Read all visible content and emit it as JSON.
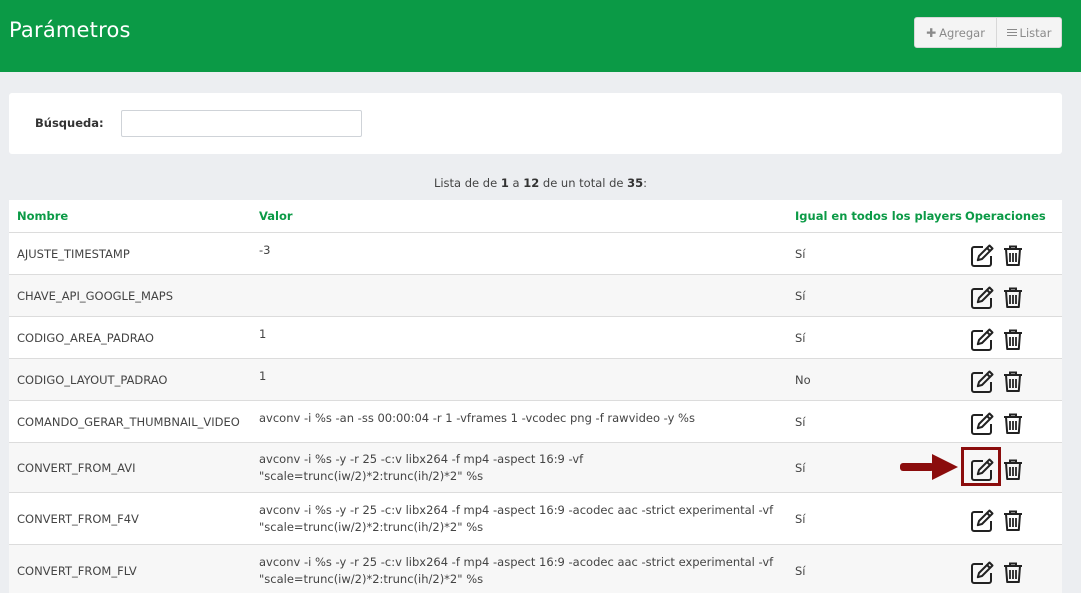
{
  "header": {
    "title": "Parámetros",
    "add_label": "Agregar",
    "list_label": "Listar"
  },
  "search": {
    "label": "Búsqueda:",
    "value": "",
    "placeholder": ""
  },
  "pagination": {
    "prefix": "Lista de de",
    "from": "1",
    "sep": "a",
    "to": "12",
    "mid": "de un total de",
    "total": "35",
    "suffix": ":"
  },
  "table": {
    "columns": [
      "Nombre",
      "Valor",
      "Igual en todos los players",
      "Operaciones"
    ],
    "rows": [
      {
        "nombre": "AJUSTE_TIMESTAMP",
        "valor": "-3",
        "igual": "Sí"
      },
      {
        "nombre": "CHAVE_API_GOOGLE_MAPS",
        "valor": "",
        "igual": "Sí"
      },
      {
        "nombre": "CODIGO_AREA_PADRAO",
        "valor": "1",
        "igual": "Sí"
      },
      {
        "nombre": "CODIGO_LAYOUT_PADRAO",
        "valor": "1",
        "igual": "No"
      },
      {
        "nombre": "COMANDO_GERAR_THUMBNAIL_VIDEO",
        "valor": "avconv -i %s -an -ss 00:00:04 -r 1 -vframes 1 -vcodec png -f rawvideo -y %s",
        "igual": "Sí"
      },
      {
        "nombre": "CONVERT_FROM_AVI",
        "valor": "avconv -i %s -y -r 25 -c:v libx264 -f mp4 -aspect 16:9 -vf \"scale=trunc(iw/2)*2:trunc(ih/2)*2\" %s",
        "igual": "Sí"
      },
      {
        "nombre": "CONVERT_FROM_F4V",
        "valor": "avconv -i %s -y -r 25 -c:v libx264 -f mp4 -aspect 16:9 -acodec aac -strict experimental -vf \"scale=trunc(iw/2)*2:trunc(ih/2)*2\" %s",
        "igual": "Sí"
      },
      {
        "nombre": "CONVERT_FROM_FLV",
        "valor": "avconv -i %s -y -r 25 -c:v libx264 -f mp4 -aspect 16:9 -acodec aac -strict experimental -vf \"scale=trunc(iw/2)*2:trunc(ih/2)*2\" %s",
        "igual": "Sí"
      }
    ]
  },
  "icons": {
    "edit": "edit-icon",
    "delete": "trash-icon",
    "annotation_arrow": "arrow-right-icon"
  },
  "colors": {
    "brand": "#0b9a46",
    "annotation": "#8b0d0d"
  }
}
